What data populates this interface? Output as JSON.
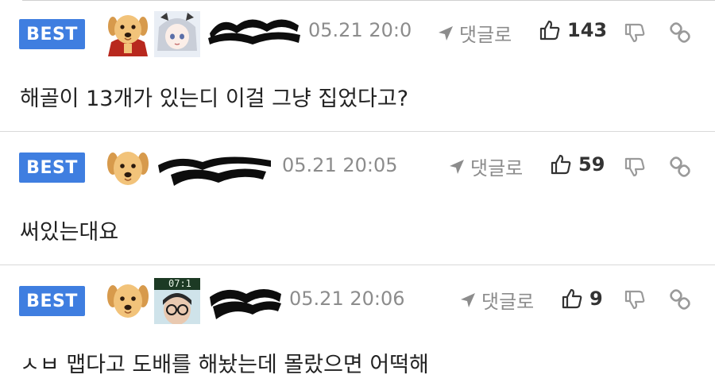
{
  "colors": {
    "best_badge": "#3f7ee0",
    "meta_gray": "#8c8c8c",
    "text": "#222222"
  },
  "comments": [
    {
      "badge": "BEST",
      "date": "05.21 20:0",
      "reply_label": "댓글로",
      "likes": "143",
      "text": "해골이 13개가 있는디 이걸 그냥 집었다고?",
      "icons": [
        "dog-avatar-icon",
        "cape-dog-avatar-icon",
        "anime-avatar-icon",
        "reply-arrow-icon",
        "thumbs-up-icon",
        "thumbs-down-icon",
        "link-icon"
      ]
    },
    {
      "badge": "BEST",
      "date": "05.21 20:05",
      "reply_label": "댓글로",
      "likes": "59",
      "text": "써있는대요",
      "icons": [
        "dog-avatar-icon",
        "reply-arrow-icon",
        "thumbs-up-icon",
        "thumbs-down-icon",
        "link-icon"
      ]
    },
    {
      "badge": "BEST",
      "date": "05.21 20:06",
      "reply_label": "댓글로",
      "likes": "9",
      "avatar_overlay": "07:1",
      "text": "ㅅㅂ 맵다고 도배를 해놨는데 몰랐으면 어떡해",
      "icons": [
        "dog-avatar-icon",
        "glasses-person-avatar-icon",
        "reply-arrow-icon",
        "thumbs-up-icon",
        "thumbs-down-icon",
        "link-icon"
      ]
    }
  ]
}
